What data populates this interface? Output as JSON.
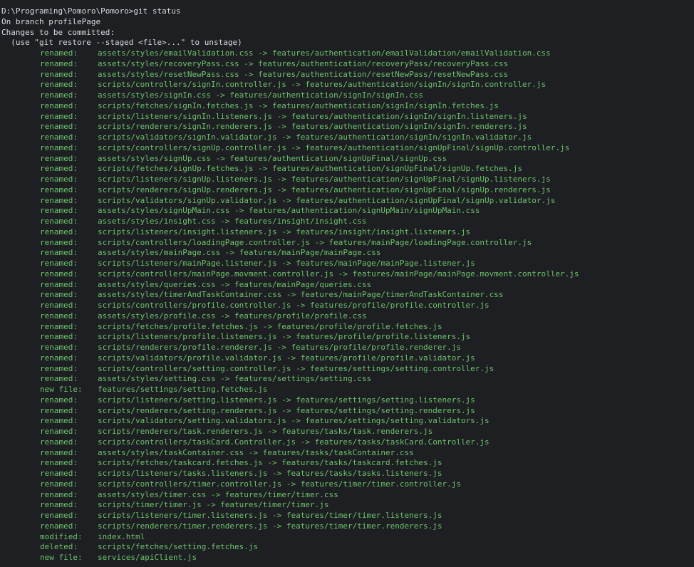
{
  "colors": {
    "background": "#1e1f22",
    "text": "#d7dadf",
    "staged": "#6cc36c"
  },
  "header_lines": [
    "D:\\Programing\\Pomoro\\Pomoro>git status",
    "On branch profilePage",
    "Changes to be committed:",
    "  (use \"git restore --staged <file>...\" to unstage)"
  ],
  "entries": [
    {
      "status": "renamed:",
      "path": "assets/styles/emailValidation.css -> features/authentication/emailValidation/emailValidation.css"
    },
    {
      "status": "renamed:",
      "path": "assets/styles/recoveryPass.css -> features/authentication/recoveryPass/recoveryPass.css"
    },
    {
      "status": "renamed:",
      "path": "assets/styles/resetNewPass.css -> features/authentication/resetNewPass/resetNewPass.css"
    },
    {
      "status": "renamed:",
      "path": "scripts/controllers/signIn.controller.js -> features/authentication/signIn/signIn.controller.js"
    },
    {
      "status": "renamed:",
      "path": "assets/styles/signIn.css -> features/authentication/signIn/signIn.css"
    },
    {
      "status": "renamed:",
      "path": "scripts/fetches/signIn.fetches.js -> features/authentication/signIn/signIn.fetches.js"
    },
    {
      "status": "renamed:",
      "path": "scripts/listeners/signIn.listeners.js -> features/authentication/signIn/signIn.listeners.js"
    },
    {
      "status": "renamed:",
      "path": "scripts/renderers/signIn.renderers.js -> features/authentication/signIn/signIn.renderers.js"
    },
    {
      "status": "renamed:",
      "path": "scripts/validators/signIn.validator.js -> features/authentication/signIn/signIn.validator.js"
    },
    {
      "status": "renamed:",
      "path": "scripts/controllers/signUp.controller.js -> features/authentication/signUpFinal/signUp.controller.js"
    },
    {
      "status": "renamed:",
      "path": "assets/styles/signUp.css -> features/authentication/signUpFinal/signUp.css"
    },
    {
      "status": "renamed:",
      "path": "scripts/fetches/signUp.fetches.js -> features/authentication/signUpFinal/signUp.fetches.js"
    },
    {
      "status": "renamed:",
      "path": "scripts/listeners/signUp.listeners.js -> features/authentication/signUpFinal/signUp.listeners.js"
    },
    {
      "status": "renamed:",
      "path": "scripts/renderers/signUp.renderers.js -> features/authentication/signUpFinal/signUp.renderers.js"
    },
    {
      "status": "renamed:",
      "path": "scripts/validators/signUp.validator.js -> features/authentication/signUpFinal/signUp.validator.js"
    },
    {
      "status": "renamed:",
      "path": "assets/styles/signUpMain.css -> features/authentication/signUpMain/signUpMain.css"
    },
    {
      "status": "renamed:",
      "path": "assets/styles/insight.css -> features/insight/insight.css"
    },
    {
      "status": "renamed:",
      "path": "scripts/listeners/insight.listeners.js -> features/insight/insight.listeners.js"
    },
    {
      "status": "renamed:",
      "path": "scripts/controllers/loadingPage.controller.js -> features/mainPage/loadingPage.controller.js"
    },
    {
      "status": "renamed:",
      "path": "assets/styles/mainPage.css -> features/mainPage/mainPage.css"
    },
    {
      "status": "renamed:",
      "path": "scripts/listeners/mainPage.listener.js -> features/mainPage/mainPage.listener.js"
    },
    {
      "status": "renamed:",
      "path": "scripts/controllers/mainPage.movment.controller.js -> features/mainPage/mainPage.movment.controller.js"
    },
    {
      "status": "renamed:",
      "path": "assets/styles/queries.css -> features/mainPage/queries.css"
    },
    {
      "status": "renamed:",
      "path": "assets/styles/timerAndTaskContainer.css -> features/mainPage/timerAndTaskContainer.css"
    },
    {
      "status": "renamed:",
      "path": "scripts/controllers/profile.controller.js -> features/profile/profile.controller.js"
    },
    {
      "status": "renamed:",
      "path": "assets/styles/profile.css -> features/profile/profile.css"
    },
    {
      "status": "renamed:",
      "path": "scripts/fetches/profile.fetches.js -> features/profile/profile.fetches.js"
    },
    {
      "status": "renamed:",
      "path": "scripts/listeners/profile.listeners.js -> features/profile/profile.listeners.js"
    },
    {
      "status": "renamed:",
      "path": "scripts/renderers/profile.renderer.js -> features/profile/profile.renderer.js"
    },
    {
      "status": "renamed:",
      "path": "scripts/validators/profile.validator.js -> features/profile/profile.validator.js"
    },
    {
      "status": "renamed:",
      "path": "scripts/controllers/setting.controller.js -> features/settings/setting.controller.js"
    },
    {
      "status": "renamed:",
      "path": "assets/styles/setting.css -> features/settings/setting.css"
    },
    {
      "status": "new file:",
      "path": "features/settings/setting.fetches.js"
    },
    {
      "status": "renamed:",
      "path": "scripts/listeners/setting.listeners.js -> features/settings/setting.listeners.js"
    },
    {
      "status": "renamed:",
      "path": "scripts/renderers/setting.renderers.js -> features/settings/setting.renderers.js"
    },
    {
      "status": "renamed:",
      "path": "scripts/validators/setting.validators.js -> features/settings/setting.validators.js"
    },
    {
      "status": "renamed:",
      "path": "scripts/renderers/task.renderers.js -> features/tasks/task.renderers.js"
    },
    {
      "status": "renamed:",
      "path": "scripts/controllers/taskCard.Controller.js -> features/tasks/taskCard.Controller.js"
    },
    {
      "status": "renamed:",
      "path": "assets/styles/taskContainer.css -> features/tasks/taskContainer.css"
    },
    {
      "status": "renamed:",
      "path": "scripts/fetches/taskcard.fetches.js -> features/tasks/taskcard.fetches.js"
    },
    {
      "status": "renamed:",
      "path": "scripts/listeners/tasks.listeners.js -> features/tasks/tasks.listeners.js"
    },
    {
      "status": "renamed:",
      "path": "scripts/controllers/timer.controller.js -> features/timer/timer.controller.js"
    },
    {
      "status": "renamed:",
      "path": "assets/styles/timer.css -> features/timer/timer.css"
    },
    {
      "status": "renamed:",
      "path": "scripts/timer/timer.js -> features/timer/timer.js"
    },
    {
      "status": "renamed:",
      "path": "scripts/listeners/timer.listeners.js -> features/timer/timer.listeners.js"
    },
    {
      "status": "renamed:",
      "path": "scripts/renderers/timer.renderers.js -> features/timer/timer.renderers.js"
    },
    {
      "status": "modified:",
      "path": "index.html"
    },
    {
      "status": "deleted:",
      "path": "scripts/fetches/setting.fetches.js"
    },
    {
      "status": "new file:",
      "path": "services/apiClient.js"
    }
  ]
}
